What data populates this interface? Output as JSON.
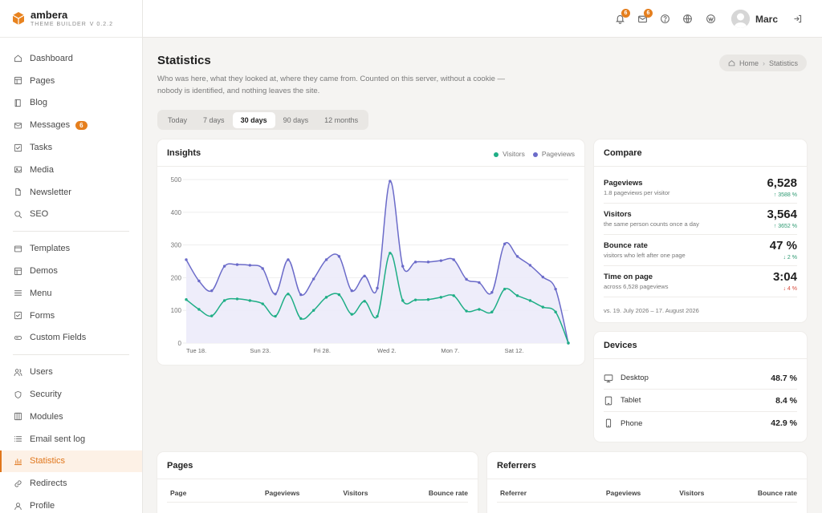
{
  "brand": {
    "name": "ambera",
    "subtitle": "THEME BUILDER",
    "version": "V 0.2.2"
  },
  "sidebar": {
    "groups": [
      [
        {
          "label": "Dashboard",
          "icon": "home-icon"
        },
        {
          "label": "Pages",
          "icon": "layout-icon"
        },
        {
          "label": "Blog",
          "icon": "book-icon"
        },
        {
          "label": "Messages",
          "icon": "mail-icon",
          "badge": "6"
        },
        {
          "label": "Tasks",
          "icon": "check-square-icon"
        },
        {
          "label": "Media",
          "icon": "image-icon"
        },
        {
          "label": "Newsletter",
          "icon": "file-icon"
        },
        {
          "label": "SEO",
          "icon": "search-icon"
        }
      ],
      [
        {
          "label": "Templates",
          "icon": "template-icon"
        },
        {
          "label": "Demos",
          "icon": "layout-icon"
        },
        {
          "label": "Menu",
          "icon": "menu-icon"
        },
        {
          "label": "Forms",
          "icon": "check-square-icon"
        },
        {
          "label": "Custom Fields",
          "icon": "input-icon"
        }
      ],
      [
        {
          "label": "Users",
          "icon": "users-icon"
        },
        {
          "label": "Security",
          "icon": "shield-icon"
        },
        {
          "label": "Modules",
          "icon": "columns-icon"
        },
        {
          "label": "Email sent log",
          "icon": "list-icon"
        },
        {
          "label": "Statistics",
          "icon": "bar-chart-icon",
          "active": true
        },
        {
          "label": "Redirects",
          "icon": "link-icon"
        },
        {
          "label": "Profile",
          "icon": "user-icon"
        }
      ]
    ]
  },
  "topbar": {
    "notifications_count": "6",
    "messages_count": "6",
    "user_name": "Marc"
  },
  "header": {
    "title": "Statistics",
    "description": "Who was here, what they looked at, where they came from. Counted on this server, without a cookie — nobody is identified, and nothing leaves the site.",
    "breadcrumb": {
      "home": "Home",
      "current": "Statistics"
    }
  },
  "range": {
    "options": [
      "Today",
      "7 days",
      "30 days",
      "90 days",
      "12 months"
    ],
    "selected": "30 days"
  },
  "insights": {
    "title": "Insights",
    "chart_data": {
      "type": "line",
      "title": "Insights",
      "ylim": [
        0,
        500
      ],
      "yticks": [
        0,
        100,
        200,
        300,
        400,
        500
      ],
      "x": [
        "Jul 18",
        "Jul 19",
        "Jul 20",
        "Jul 21",
        "Jul 22",
        "Jul 23",
        "Jul 24",
        "Jul 25",
        "Jul 26",
        "Jul 27",
        "Jul 28",
        "Jul 29",
        "Jul 30",
        "Jul 31",
        "Aug 1",
        "Aug 2",
        "Aug 3",
        "Aug 4",
        "Aug 5",
        "Aug 6",
        "Aug 7",
        "Aug 8",
        "Aug 9",
        "Aug 10",
        "Aug 11",
        "Aug 12",
        "Aug 13",
        "Aug 14",
        "Aug 15",
        "Aug 16",
        "Aug 17"
      ],
      "xtick_labels": [
        {
          "index": 0,
          "label": "Tue 18."
        },
        {
          "index": 5,
          "label": "Sun 23."
        },
        {
          "index": 10,
          "label": "Fri 28."
        },
        {
          "index": 15,
          "label": "Wed 2."
        },
        {
          "index": 20,
          "label": "Mon 7."
        },
        {
          "index": 25,
          "label": "Sat 12."
        }
      ],
      "series": [
        {
          "name": "Pageviews",
          "color": "#6b6bc9",
          "values": [
            255,
            190,
            160,
            235,
            240,
            238,
            228,
            150,
            255,
            148,
            196,
            255,
            265,
            160,
            205,
            168,
            495,
            235,
            248,
            248,
            252,
            255,
            195,
            185,
            155,
            303,
            265,
            238,
            202,
            165,
            0
          ]
        },
        {
          "name": "Visitors",
          "color": "#1fae86",
          "values": [
            133,
            103,
            83,
            130,
            135,
            130,
            120,
            82,
            150,
            75,
            100,
            140,
            148,
            88,
            128,
            82,
            275,
            130,
            132,
            133,
            140,
            145,
            98,
            103,
            95,
            165,
            145,
            130,
            110,
            95,
            0
          ]
        }
      ],
      "legend": "top-right",
      "grid": true
    }
  },
  "compare": {
    "title": "Compare",
    "rows": [
      {
        "label": "Pageviews",
        "sub": "1.8 pageviews per visitor",
        "value": "6,528",
        "delta": "↑ 3588 %",
        "dir": "up"
      },
      {
        "label": "Visitors",
        "sub": "the same person counts once a day",
        "value": "3,564",
        "delta": "↑ 3652 %",
        "dir": "up"
      },
      {
        "label": "Bounce rate",
        "sub": "visitors who left after one page",
        "value": "47 %",
        "delta": "↓ 2 %",
        "dir": "up"
      },
      {
        "label": "Time on page",
        "sub": "across 6,528 pageviews",
        "value": "3:04",
        "delta": "↓ 4 %",
        "dir": "down"
      }
    ],
    "note": "vs. 19. July 2026 – 17. August 2026"
  },
  "devices": {
    "title": "Devices",
    "rows": [
      {
        "label": "Desktop",
        "value": "48.7 %",
        "icon": "monitor-icon"
      },
      {
        "label": "Tablet",
        "value": "8.4 %",
        "icon": "tablet-icon"
      },
      {
        "label": "Phone",
        "value": "42.9 %",
        "icon": "phone-icon"
      }
    ]
  },
  "pages_table": {
    "title": "Pages",
    "columns": [
      "Page",
      "Pageviews",
      "Visitors",
      "Bounce rate"
    ]
  },
  "referrers_table": {
    "title": "Referrers",
    "columns": [
      "Referrer",
      "Pageviews",
      "Visitors",
      "Bounce rate"
    ]
  },
  "colors": {
    "accent": "#e0761b",
    "visitors": "#1fae86",
    "pageviews": "#6b6bc9"
  }
}
